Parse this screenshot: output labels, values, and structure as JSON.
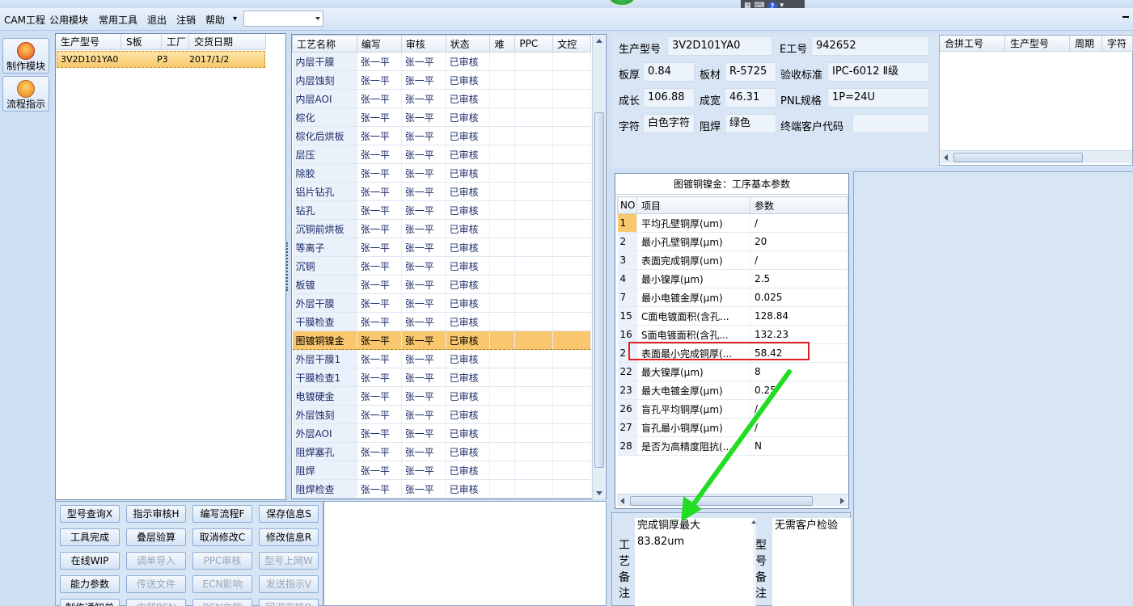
{
  "menubar": {
    "items": [
      "CAM工程",
      "公用模块",
      "常用工具",
      "退出",
      "注销",
      "帮助"
    ],
    "help_dropdown": "▾",
    "combo_value": ""
  },
  "float_toolbar": {
    "kbd": "⌨",
    "help": "?"
  },
  "left_toolbar": {
    "buttons": [
      "制作模块",
      "流程指示"
    ]
  },
  "orders": {
    "columns": [
      "生产型号",
      "S板",
      "工厂",
      "交货日期"
    ],
    "rows": [
      {
        "model": "3V2D101YA0",
        "s": "",
        "factory": "P3",
        "date": "2017/1/2"
      }
    ]
  },
  "process": {
    "columns": [
      "工艺名称",
      "编写",
      "审核",
      "状态",
      "难",
      "PPC",
      "文控"
    ],
    "rows": [
      [
        "内层干膜",
        "张一平",
        "张一平",
        "已审核"
      ],
      [
        "内层蚀刻",
        "张一平",
        "张一平",
        "已审核"
      ],
      [
        "内层AOI",
        "张一平",
        "张一平",
        "已审核"
      ],
      [
        "棕化",
        "张一平",
        "张一平",
        "已审核"
      ],
      [
        "棕化后烘板",
        "张一平",
        "张一平",
        "已审核"
      ],
      [
        "层压",
        "张一平",
        "张一平",
        "已审核"
      ],
      [
        "除胶",
        "张一平",
        "张一平",
        "已审核"
      ],
      [
        "铝片钻孔",
        "张一平",
        "张一平",
        "已审核"
      ],
      [
        "钻孔",
        "张一平",
        "张一平",
        "已审核"
      ],
      [
        "沉铜前烘板",
        "张一平",
        "张一平",
        "已审核"
      ],
      [
        "等离子",
        "张一平",
        "张一平",
        "已审核"
      ],
      [
        "沉铜",
        "张一平",
        "张一平",
        "已审核"
      ],
      [
        "板镀",
        "张一平",
        "张一平",
        "已审核"
      ],
      [
        "外层干膜",
        "张一平",
        "张一平",
        "已审核"
      ],
      [
        "干膜检查",
        "张一平",
        "张一平",
        "已审核"
      ],
      [
        "图镀铜镍金",
        "张一平",
        "张一平",
        "已审核"
      ],
      [
        "外层干膜1",
        "张一平",
        "张一平",
        "已审核"
      ],
      [
        "干膜检查1",
        "张一平",
        "张一平",
        "已审核"
      ],
      [
        "电镀硬金",
        "张一平",
        "张一平",
        "已审核"
      ],
      [
        "外层蚀刻",
        "张一平",
        "张一平",
        "已审核"
      ],
      [
        "外层AOI",
        "张一平",
        "张一平",
        "已审核"
      ],
      [
        "阻焊塞孔",
        "张一平",
        "张一平",
        "已审核"
      ],
      [
        "阻焊",
        "张一平",
        "张一平",
        "已审核"
      ],
      [
        "阻焊检查",
        "张一平",
        "张一平",
        "已审核"
      ]
    ],
    "selected_index": 15
  },
  "info": {
    "model_label": "生产型号",
    "model_value": "3V2D101YA0",
    "e_label": "E工号",
    "e_value": "942652",
    "thick_label": "板厚",
    "thick_value": "0.84",
    "material_label": "板材",
    "material_value": "R-5725",
    "std_label": "验收标准",
    "std_value": "IPC-6012 Ⅱ级",
    "len_label": "成长",
    "len_value": "106.88",
    "wid_label": "成宽",
    "wid_value": "46.31",
    "pnl_label": "PNL规格",
    "pnl_value": "1P=24U",
    "char_label": "字符",
    "char_value": "白色字符",
    "mask_label": "阻焊",
    "mask_value": "绿色",
    "cust_label": "终端客户代码",
    "cust_value": ""
  },
  "merged": {
    "columns": [
      "合拼工号",
      "生产型号",
      "周期",
      "字符"
    ]
  },
  "params": {
    "title": "图镀铜镍金：工序基本参数",
    "columns": [
      "NO",
      "项目",
      "参数"
    ],
    "rows": [
      [
        "1",
        "平均孔壁铜厚(um)",
        "/"
      ],
      [
        "2",
        "最小孔壁铜厚(μm)",
        "20"
      ],
      [
        "3",
        "表面完成铜厚(um)",
        "/"
      ],
      [
        "4",
        "最小镍厚(μm)",
        "2.5"
      ],
      [
        "7",
        "最小电镀金厚(μm)",
        "0.025"
      ],
      [
        "15",
        "C面电镀面积(含孔...",
        "128.84"
      ],
      [
        "16",
        "S面电镀面积(含孔...",
        "132.23"
      ],
      [
        "2",
        "表面最小完成铜厚(...",
        "58.42"
      ],
      [
        "22",
        "最大镍厚(μm)",
        "8"
      ],
      [
        "23",
        "最大电镀金厚(μm)",
        "0.25"
      ],
      [
        "26",
        "盲孔平均铜厚(μm)",
        "/"
      ],
      [
        "27",
        "盲孔最小铜厚(μm)",
        "/"
      ],
      [
        "28",
        "是否为高精度阻抗(...",
        "N"
      ]
    ]
  },
  "buttons": {
    "row1": [
      "型号查询X",
      "指示审核H",
      "编写流程F",
      "保存信息S"
    ],
    "row2": [
      "工具完成",
      "叠层验算",
      "取消修改C",
      "修改信息R"
    ],
    "row3": [
      "在线WIP",
      "调单导入",
      "PPC审核",
      "型号上网W"
    ],
    "row4": [
      "能力参数",
      "传送文件",
      "ECN影响",
      "发送指示V"
    ],
    "row5": [
      "制作通知单",
      "内部PCN",
      "PCN文控",
      "回退审核D"
    ]
  },
  "notes": {
    "process_label": "工艺备注",
    "process_text_1": "完成铜厚最大",
    "process_text_2": "83.82um",
    "model_label": "型号备注",
    "model_text": "无需客户检验"
  },
  "colors": {
    "accent": "#f9c76d",
    "annotation_box": "#e02020",
    "annotation_arrow": "#22dd22"
  }
}
